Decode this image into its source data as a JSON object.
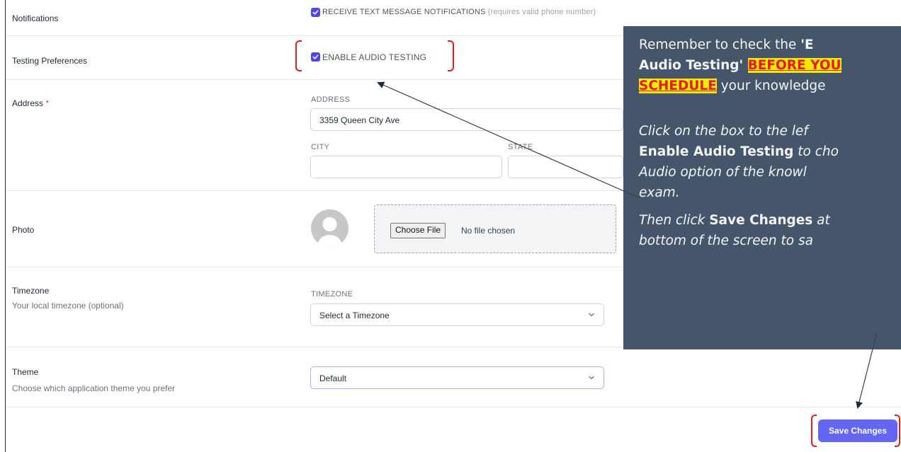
{
  "notifications": {
    "label": "Notifications",
    "sms_label": "RECEIVE TEXT MESSAGE NOTIFICATIONS",
    "sms_hint": "(requires valid phone number)",
    "sms_checked": true
  },
  "testing": {
    "label": "Testing Preferences",
    "audio_label": "ENABLE AUDIO TESTING",
    "audio_checked": true
  },
  "address": {
    "label": "Address",
    "required_mark": "*",
    "address_label": "ADDRESS",
    "address_value": "3359 Queen City Ave",
    "city_label": "CITY",
    "city_value": "",
    "state_label": "STATE",
    "state_value": ""
  },
  "photo": {
    "label": "Photo",
    "choose_file": "Choose File",
    "no_file": "No file chosen"
  },
  "timezone": {
    "label": "Timezone",
    "sublabel": "Your local timezone (optional)",
    "field_label": "TIMEZONE",
    "selected": "Select a Timezone"
  },
  "theme": {
    "label": "Theme",
    "sublabel": "Choose which application theme you prefer",
    "selected": "Default"
  },
  "save_button": "Save Changes",
  "callout": {
    "l1a": "Remember to check the ",
    "l1b": "'E",
    "l2a": "Audio Testing' ",
    "l2b": "BEFORE YOU",
    "l3a": "SCHEDULE",
    "l3b": " your knowledge",
    "l4": "Click on the box to the lef",
    "l5a": "Enable Audio Testing",
    "l5b": " to cho",
    "l6": "Audio option of the knowl",
    "l7": "exam.",
    "l8a": "Then click ",
    "l8b": "Save Changes",
    "l8c": " at",
    "l9": "bottom of the screen to sa"
  },
  "colors": {
    "accent": "#6366f1",
    "checkbox": "#4f46e5",
    "callout_bg": "#46566a",
    "highlight": "#f4e900",
    "annotation_red": "#e11d1d"
  }
}
